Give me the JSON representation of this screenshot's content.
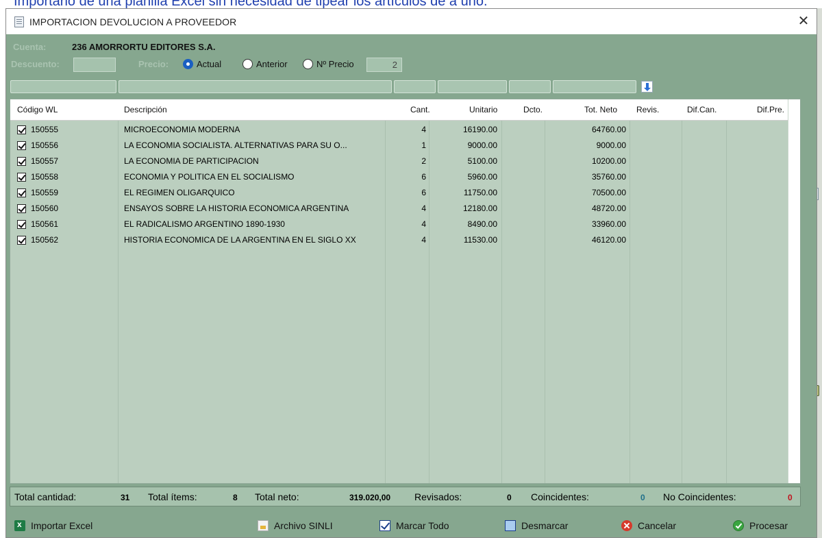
{
  "background_caption": "Importarlo de una planilla Excel sin necesidad de tipear los artículos de a uno.",
  "window": {
    "title": "IMPORTACION DEVOLUCION A PROVEEDOR",
    "close_glyph": "✕"
  },
  "header": {
    "cuenta_label": "Cuenta:",
    "cuenta_value": "236 AMORRORTU EDITORES S.A.",
    "descuento_label": "Descuento:",
    "descuento_value": "",
    "precio_label": "Precio:",
    "precio_options": [
      {
        "label": "Actual",
        "selected": true
      },
      {
        "label": "Anterior",
        "selected": false
      },
      {
        "label": "Nº Precio",
        "selected": false
      }
    ],
    "nprecio_value": "2"
  },
  "table": {
    "columns": [
      "Código WL",
      "Descripción",
      "Cant.",
      "Unitario",
      "Dcto.",
      "Tot. Neto",
      "Revis.",
      "Dif.Can.",
      "Dif.Pre."
    ],
    "rows": [
      {
        "checked": true,
        "code": "150555",
        "desc": "MICROECONOMIA MODERNA",
        "cant": "4",
        "unit": "16190.00",
        "dcto": "",
        "neto": "64760.00",
        "revis": "",
        "difcan": "",
        "difpre": ""
      },
      {
        "checked": true,
        "code": "150556",
        "desc": "LA ECONOMIA SOCIALISTA. ALTERNATIVAS PARA SU O...",
        "cant": "1",
        "unit": "9000.00",
        "dcto": "",
        "neto": "9000.00",
        "revis": "",
        "difcan": "",
        "difpre": ""
      },
      {
        "checked": true,
        "code": "150557",
        "desc": "LA ECONOMIA DE PARTICIPACION",
        "cant": "2",
        "unit": "5100.00",
        "dcto": "",
        "neto": "10200.00",
        "revis": "",
        "difcan": "",
        "difpre": ""
      },
      {
        "checked": true,
        "code": "150558",
        "desc": "ECONOMIA Y POLITICA EN EL SOCIALISMO",
        "cant": "6",
        "unit": "5960.00",
        "dcto": "",
        "neto": "35760.00",
        "revis": "",
        "difcan": "",
        "difpre": ""
      },
      {
        "checked": true,
        "code": "150559",
        "desc": "EL REGIMEN OLIGARQUICO",
        "cant": "6",
        "unit": "11750.00",
        "dcto": "",
        "neto": "70500.00",
        "revis": "",
        "difcan": "",
        "difpre": ""
      },
      {
        "checked": true,
        "code": "150560",
        "desc": "ENSAYOS SOBRE LA HISTORIA ECONOMICA ARGENTINA",
        "cant": "4",
        "unit": "12180.00",
        "dcto": "",
        "neto": "48720.00",
        "revis": "",
        "difcan": "",
        "difpre": ""
      },
      {
        "checked": true,
        "code": "150561",
        "desc": "EL RADICALISMO ARGENTINO  1890-1930",
        "cant": "4",
        "unit": "8490.00",
        "dcto": "",
        "neto": "33960.00",
        "revis": "",
        "difcan": "",
        "difpre": ""
      },
      {
        "checked": true,
        "code": "150562",
        "desc": "HISTORIA ECONOMICA DE LA ARGENTINA EN EL SIGLO XX",
        "cant": "4",
        "unit": "11530.00",
        "dcto": "",
        "neto": "46120.00",
        "revis": "",
        "difcan": "",
        "difpre": ""
      }
    ]
  },
  "totals": {
    "cantidad_label": "Total cantidad:",
    "cantidad_value": "31",
    "items_label": "Total ítems:",
    "items_value": "8",
    "neto_label": "Total neto:",
    "neto_value": "319.020,00",
    "revisados_label": "Revisados:",
    "revisados_value": "0",
    "coincidentes_label": "Coincidentes:",
    "coincidentes_value": "0",
    "no_coincidentes_label": "No Coincidentes:",
    "no_coincidentes_value": "0"
  },
  "buttons": {
    "importar": "Importar Excel",
    "sinli": "Archivo SINLI",
    "marcar": "Marcar Todo",
    "desmarcar": "Desmarcar",
    "cancelar": "Cancelar",
    "procesar": "Procesar"
  },
  "colors": {
    "window_bg": "#86a78f",
    "grid_bg": "#bbcfbf",
    "coincidentes": "#1f6f8a",
    "no_coincidentes": "#c0121d"
  }
}
